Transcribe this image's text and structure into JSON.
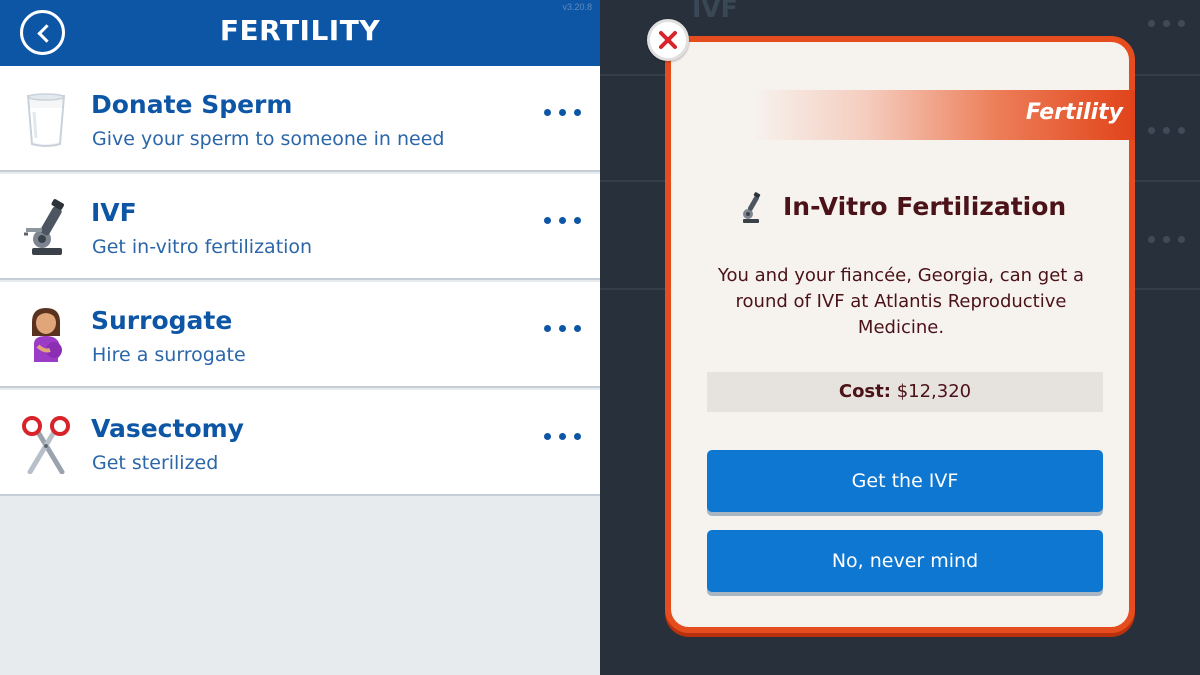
{
  "header": {
    "title": "FERTILITY",
    "version": "v3.20.8"
  },
  "actions": [
    {
      "title": "Donate Sperm",
      "subtitle": "Give your sperm to someone in need",
      "icon": "milk-glass-icon"
    },
    {
      "title": "IVF",
      "subtitle": "Get in-vitro fertilization",
      "icon": "microscope-icon"
    },
    {
      "title": "Surrogate",
      "subtitle": "Hire a surrogate",
      "icon": "pregnant-woman-icon"
    },
    {
      "title": "Vasectomy",
      "subtitle": "Get sterilized",
      "icon": "scissors-icon"
    }
  ],
  "background": {
    "first_row_title": "IVF"
  },
  "modal": {
    "banner": "Fertility",
    "title": "In-Vitro Fertilization",
    "body": "You and your fiancée, Georgia, can get a round of IVF at Atlantis Reproductive Medicine.",
    "cost_label": "Cost:",
    "cost_value": "$12,320",
    "confirm_label": "Get the IVF",
    "cancel_label": "No, never mind"
  },
  "colors": {
    "header_blue": "#0d56a6",
    "button_blue": "#0d77d2",
    "modal_border": "#e64d1e",
    "modal_text": "#4b1217"
  }
}
